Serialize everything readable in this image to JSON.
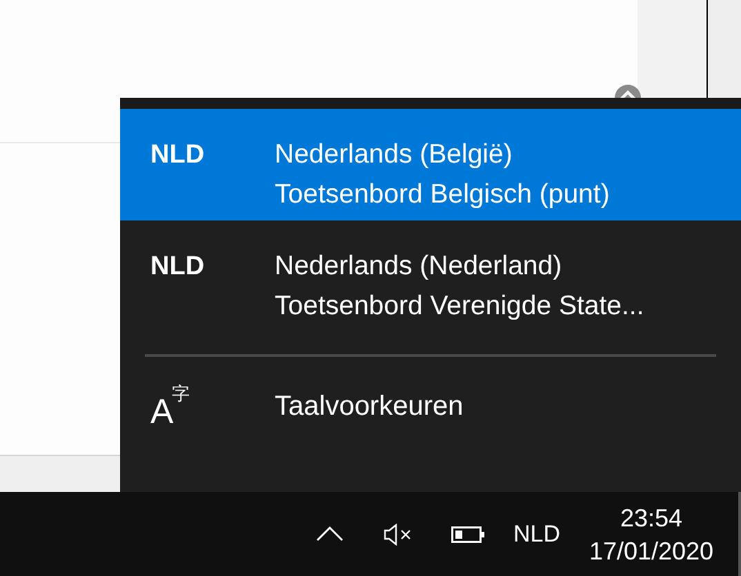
{
  "flyout": {
    "languages": [
      {
        "code": "NLD",
        "name": "Nederlands (België)",
        "keyboard": "Toetsenbord Belgisch (punt)",
        "selected": true
      },
      {
        "code": "NLD",
        "name": "Nederlands (Nederland)",
        "keyboard": "Toetsenbord Verenigde State...",
        "selected": false
      }
    ],
    "preferences": {
      "icon_letter": "A",
      "icon_char": "字",
      "label": "Taalvoorkeuren"
    }
  },
  "taskbar": {
    "input_indicator": "NLD",
    "time": "23:54",
    "date": "17/01/2020"
  }
}
